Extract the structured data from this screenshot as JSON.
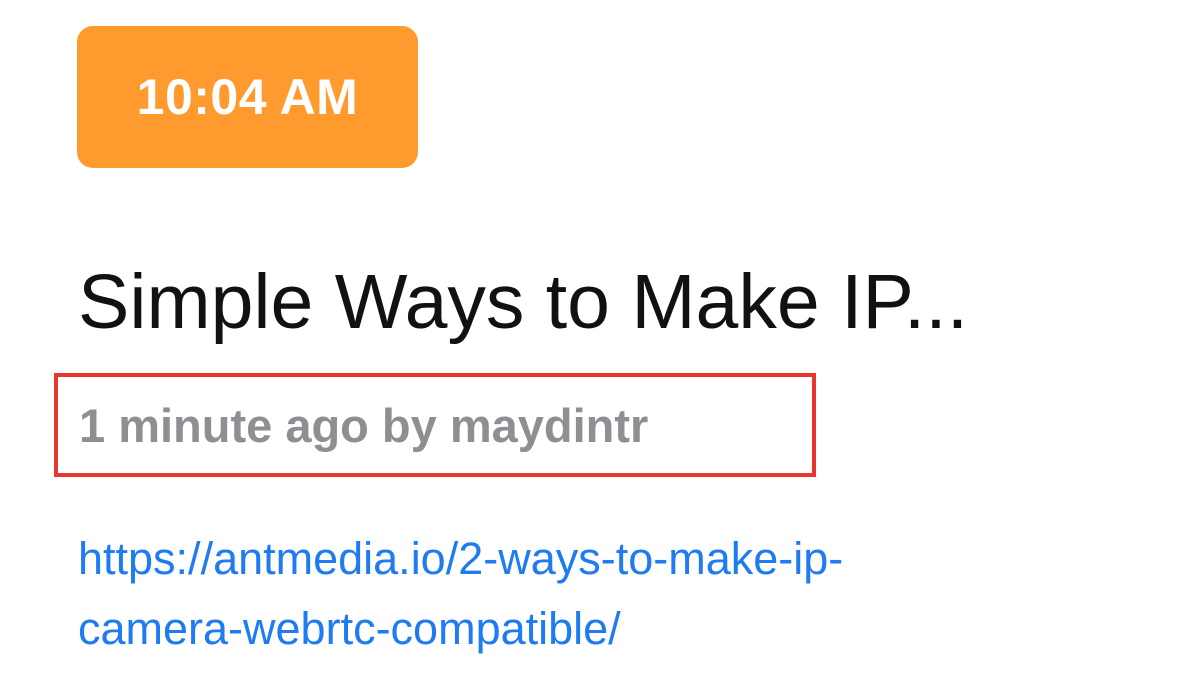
{
  "badge": {
    "time": "10:04 AM"
  },
  "post": {
    "title": "Simple Ways to Make IP...",
    "meta": "1 minute ago by maydintr",
    "link_line1": "https://antmedia.io/2-ways-to-make-ip-",
    "link_line2": "camera-webrtc-compatible/"
  },
  "colors": {
    "badge_bg": "#FF9A2E",
    "meta_text": "#8E8E93",
    "highlight_border": "#E8352D",
    "link": "#1E7BF2"
  }
}
